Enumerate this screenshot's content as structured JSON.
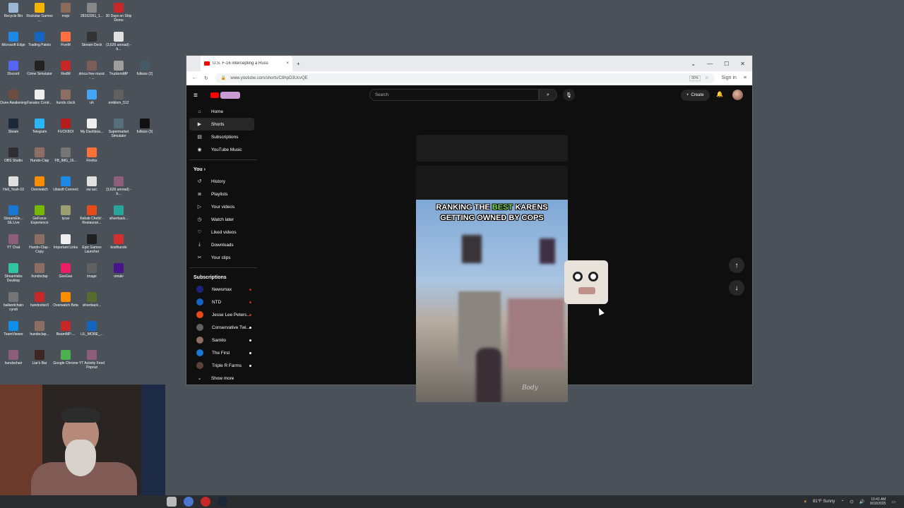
{
  "desktop": {
    "icons": [
      {
        "label": "Recycle Bin",
        "color": "#9bb7d4"
      },
      {
        "label": "Rockstar Games ...",
        "color": "#f4b400"
      },
      {
        "label": "mojo",
        "color": "#8a6a5a"
      },
      {
        "label": "28162261_1...",
        "color": "#888888"
      },
      {
        "label": "30 Days on Ship Demo",
        "color": "#c62828"
      },
      {
        "label": "Microsoft Edge",
        "color": "#1e88e5"
      },
      {
        "label": "Trading Paints",
        "color": "#1565c0"
      },
      {
        "label": "FiveM",
        "color": "#ff7043"
      },
      {
        "label": "Stream Deck",
        "color": "#333333"
      },
      {
        "label": "(3,626 unread) - b...",
        "color": "#e0e0e0"
      },
      {
        "label": "Discord",
        "color": "#5865f2"
      },
      {
        "label": "Crime Simulator",
        "color": "#222222"
      },
      {
        "label": "RedM",
        "color": "#c62828"
      },
      {
        "label": "dmca free music - ...",
        "color": "#7b5e57"
      },
      {
        "label": "TruckersMP",
        "color": "#9e9e9e"
      },
      {
        "label": "fullsize (2)",
        "color": "#455a64"
      },
      {
        "label": "Dune Awakening",
        "color": "#6d4c41"
      },
      {
        "label": "Fanatec Contr...",
        "color": "#eeeeee"
      },
      {
        "label": "hundo clock",
        "color": "#8d6e63"
      },
      {
        "label": "uh",
        "color": "#42a5f5"
      },
      {
        "label": "emblem_512",
        "color": "#616161"
      },
      {
        "label": "Steam",
        "color": "#1b2838"
      },
      {
        "label": "Telegram",
        "color": "#29b6f6"
      },
      {
        "label": "FUCKBOI",
        "color": "#b71c1c"
      },
      {
        "label": "My Dashboa...",
        "color": "#eeeeee"
      },
      {
        "label": "Supermarket Simulator",
        "color": "#546e7a"
      },
      {
        "label": "fullsize (3)",
        "color": "#111111"
      },
      {
        "label": "OBS Studio",
        "color": "#302e31"
      },
      {
        "label": "Hundo-Clap",
        "color": "#8d6e63"
      },
      {
        "label": "FB_IMG_16...",
        "color": "#757575"
      },
      {
        "label": "Firefox",
        "color": "#ff7139"
      },
      {
        "label": "Hell_Yeah-10",
        "color": "#e0e0e0"
      },
      {
        "label": "Overwatch",
        "color": "#fb8c00"
      },
      {
        "label": "Ubisoft Connect",
        "color": "#1e88e5"
      },
      {
        "label": "ow acc",
        "color": "#e0e0e0"
      },
      {
        "label": "(3,626 unread) - b...",
        "color": "#8e5d7a"
      },
      {
        "label": "StreamEle... SE.Live",
        "color": "#1976d2"
      },
      {
        "label": "GeForce Experience",
        "color": "#76b900"
      },
      {
        "label": "tycar",
        "color": "#9e9e73"
      },
      {
        "label": "Kebab Chefs! - Restauran...",
        "color": "#e64a19"
      },
      {
        "label": "silverback...",
        "color": "#26a69a"
      },
      {
        "label": "YT Chat",
        "color": "#8e5d7a"
      },
      {
        "label": "Hundo-Clap - Copy",
        "color": "#8d6e63"
      },
      {
        "label": "Important Links",
        "color": "#eeeeee"
      },
      {
        "label": "Epic Games Launcher",
        "color": "#212121"
      },
      {
        "label": "koolhundo",
        "color": "#d32f2f"
      },
      {
        "label": "Streamlabs Desktop",
        "color": "#31c3a2"
      },
      {
        "label": "hundoclap",
        "color": "#8d6e63"
      },
      {
        "label": "GeeGee",
        "color": "#e91e63"
      },
      {
        "label": "image",
        "color": "#616161"
      },
      {
        "label": "omatv",
        "color": "#4a148c"
      },
      {
        "label": "ballandchain cyndi",
        "color": "#757575"
      },
      {
        "label": "hundostier3",
        "color": "#c62828"
      },
      {
        "label": "Overwatch Beta",
        "color": "#fb8c00"
      },
      {
        "label": "silverback...",
        "color": "#556b2f"
      },
      {
        "label": "TeamViewer",
        "color": "#0e8ee9"
      },
      {
        "label": "hundoclap...",
        "color": "#8d6e63"
      },
      {
        "label": "BeamMP-...",
        "color": "#c62828"
      },
      {
        "label": "LIL_MORE_...",
        "color": "#1565c0"
      },
      {
        "label": "hundochair",
        "color": "#8e5d7a"
      },
      {
        "label": "Liar's Bar",
        "color": "#3e2723"
      },
      {
        "label": "Google Chrome",
        "color": "#4caf50"
      },
      {
        "label": "YT Activity Feed Popout",
        "color": "#8e5d7a"
      }
    ]
  },
  "browser": {
    "tab_title": "U.S. F-16 intercepting a Russ",
    "tab_close": "×",
    "new_tab": "+",
    "window_controls": [
      "⌄",
      "—",
      "☐",
      "✕"
    ],
    "url": "www.youtube.com/shorts/C8hpD3UcvQE",
    "zoom": "90%",
    "back": "←",
    "reload": "↻",
    "star": "☆",
    "signin": "Sign in",
    "menu": "≡"
  },
  "youtube": {
    "search_placeholder": "Search",
    "create_label": "Create",
    "sidebar": {
      "main": [
        {
          "label": "Home",
          "icon": "⌂"
        },
        {
          "label": "Shorts",
          "icon": "▶"
        },
        {
          "label": "Subscriptions",
          "icon": "▤"
        },
        {
          "label": "YouTube Music",
          "icon": "◉"
        }
      ],
      "you_heading": "You",
      "you": [
        {
          "label": "History",
          "icon": "↺"
        },
        {
          "label": "Playlists",
          "icon": "≣"
        },
        {
          "label": "Your videos",
          "icon": "▷"
        },
        {
          "label": "Watch later",
          "icon": "◷"
        },
        {
          "label": "Liked videos",
          "icon": "♡"
        },
        {
          "label": "Downloads",
          "icon": "⤓"
        },
        {
          "label": "Your clips",
          "icon": "✂"
        }
      ],
      "subs_heading": "Subscriptions",
      "subs": [
        {
          "label": "Newsmax",
          "color": "#1a237e",
          "dot": "#c62828"
        },
        {
          "label": "NTD",
          "color": "#1565c0",
          "dot": "#c62828"
        },
        {
          "label": "Jesse Lee Peters...",
          "color": "#e64a19",
          "dot": "#c62828"
        },
        {
          "label": "Conservative Twi...",
          "color": "#616161",
          "dot": "#ffffff"
        },
        {
          "label": "Samito",
          "color": "#8d6e63",
          "dot": "#ffffff"
        },
        {
          "label": "The First",
          "color": "#1976d2",
          "dot": "#ffffff"
        },
        {
          "label": "Triple R Farms",
          "color": "#5d4037",
          "dot": "#ffffff"
        }
      ],
      "show_more": "Show more"
    },
    "short": {
      "caption_line1_pre": "RANKING THE ",
      "caption_line1_hl": "BEST",
      "caption_line1_post": " KARENS",
      "caption_line2": "GETTING OWNED BY COPS",
      "watermark": "Body"
    }
  },
  "taskbar": {
    "weather": "81°F  Sunny",
    "time": "10:41 AM",
    "date": "8/18/2025"
  }
}
